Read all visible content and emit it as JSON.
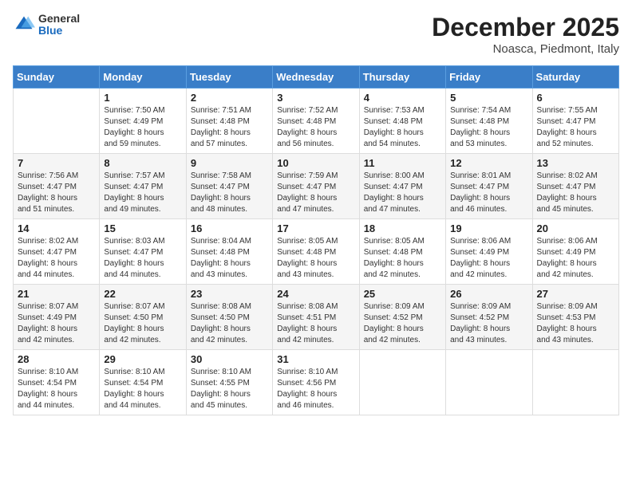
{
  "header": {
    "logo_general": "General",
    "logo_blue": "Blue",
    "month": "December 2025",
    "location": "Noasca, Piedmont, Italy"
  },
  "weekdays": [
    "Sunday",
    "Monday",
    "Tuesday",
    "Wednesday",
    "Thursday",
    "Friday",
    "Saturday"
  ],
  "weeks": [
    [
      {
        "day": "",
        "info": ""
      },
      {
        "day": "1",
        "info": "Sunrise: 7:50 AM\nSunset: 4:49 PM\nDaylight: 8 hours\nand 59 minutes."
      },
      {
        "day": "2",
        "info": "Sunrise: 7:51 AM\nSunset: 4:48 PM\nDaylight: 8 hours\nand 57 minutes."
      },
      {
        "day": "3",
        "info": "Sunrise: 7:52 AM\nSunset: 4:48 PM\nDaylight: 8 hours\nand 56 minutes."
      },
      {
        "day": "4",
        "info": "Sunrise: 7:53 AM\nSunset: 4:48 PM\nDaylight: 8 hours\nand 54 minutes."
      },
      {
        "day": "5",
        "info": "Sunrise: 7:54 AM\nSunset: 4:48 PM\nDaylight: 8 hours\nand 53 minutes."
      },
      {
        "day": "6",
        "info": "Sunrise: 7:55 AM\nSunset: 4:47 PM\nDaylight: 8 hours\nand 52 minutes."
      }
    ],
    [
      {
        "day": "7",
        "info": "Sunrise: 7:56 AM\nSunset: 4:47 PM\nDaylight: 8 hours\nand 51 minutes."
      },
      {
        "day": "8",
        "info": "Sunrise: 7:57 AM\nSunset: 4:47 PM\nDaylight: 8 hours\nand 49 minutes."
      },
      {
        "day": "9",
        "info": "Sunrise: 7:58 AM\nSunset: 4:47 PM\nDaylight: 8 hours\nand 48 minutes."
      },
      {
        "day": "10",
        "info": "Sunrise: 7:59 AM\nSunset: 4:47 PM\nDaylight: 8 hours\nand 47 minutes."
      },
      {
        "day": "11",
        "info": "Sunrise: 8:00 AM\nSunset: 4:47 PM\nDaylight: 8 hours\nand 47 minutes."
      },
      {
        "day": "12",
        "info": "Sunrise: 8:01 AM\nSunset: 4:47 PM\nDaylight: 8 hours\nand 46 minutes."
      },
      {
        "day": "13",
        "info": "Sunrise: 8:02 AM\nSunset: 4:47 PM\nDaylight: 8 hours\nand 45 minutes."
      }
    ],
    [
      {
        "day": "14",
        "info": "Sunrise: 8:02 AM\nSunset: 4:47 PM\nDaylight: 8 hours\nand 44 minutes."
      },
      {
        "day": "15",
        "info": "Sunrise: 8:03 AM\nSunset: 4:47 PM\nDaylight: 8 hours\nand 44 minutes."
      },
      {
        "day": "16",
        "info": "Sunrise: 8:04 AM\nSunset: 4:48 PM\nDaylight: 8 hours\nand 43 minutes."
      },
      {
        "day": "17",
        "info": "Sunrise: 8:05 AM\nSunset: 4:48 PM\nDaylight: 8 hours\nand 43 minutes."
      },
      {
        "day": "18",
        "info": "Sunrise: 8:05 AM\nSunset: 4:48 PM\nDaylight: 8 hours\nand 42 minutes."
      },
      {
        "day": "19",
        "info": "Sunrise: 8:06 AM\nSunset: 4:49 PM\nDaylight: 8 hours\nand 42 minutes."
      },
      {
        "day": "20",
        "info": "Sunrise: 8:06 AM\nSunset: 4:49 PM\nDaylight: 8 hours\nand 42 minutes."
      }
    ],
    [
      {
        "day": "21",
        "info": "Sunrise: 8:07 AM\nSunset: 4:49 PM\nDaylight: 8 hours\nand 42 minutes."
      },
      {
        "day": "22",
        "info": "Sunrise: 8:07 AM\nSunset: 4:50 PM\nDaylight: 8 hours\nand 42 minutes."
      },
      {
        "day": "23",
        "info": "Sunrise: 8:08 AM\nSunset: 4:50 PM\nDaylight: 8 hours\nand 42 minutes."
      },
      {
        "day": "24",
        "info": "Sunrise: 8:08 AM\nSunset: 4:51 PM\nDaylight: 8 hours\nand 42 minutes."
      },
      {
        "day": "25",
        "info": "Sunrise: 8:09 AM\nSunset: 4:52 PM\nDaylight: 8 hours\nand 42 minutes."
      },
      {
        "day": "26",
        "info": "Sunrise: 8:09 AM\nSunset: 4:52 PM\nDaylight: 8 hours\nand 43 minutes."
      },
      {
        "day": "27",
        "info": "Sunrise: 8:09 AM\nSunset: 4:53 PM\nDaylight: 8 hours\nand 43 minutes."
      }
    ],
    [
      {
        "day": "28",
        "info": "Sunrise: 8:10 AM\nSunset: 4:54 PM\nDaylight: 8 hours\nand 44 minutes."
      },
      {
        "day": "29",
        "info": "Sunrise: 8:10 AM\nSunset: 4:54 PM\nDaylight: 8 hours\nand 44 minutes."
      },
      {
        "day": "30",
        "info": "Sunrise: 8:10 AM\nSunset: 4:55 PM\nDaylight: 8 hours\nand 45 minutes."
      },
      {
        "day": "31",
        "info": "Sunrise: 8:10 AM\nSunset: 4:56 PM\nDaylight: 8 hours\nand 46 minutes."
      },
      {
        "day": "",
        "info": ""
      },
      {
        "day": "",
        "info": ""
      },
      {
        "day": "",
        "info": ""
      }
    ]
  ]
}
